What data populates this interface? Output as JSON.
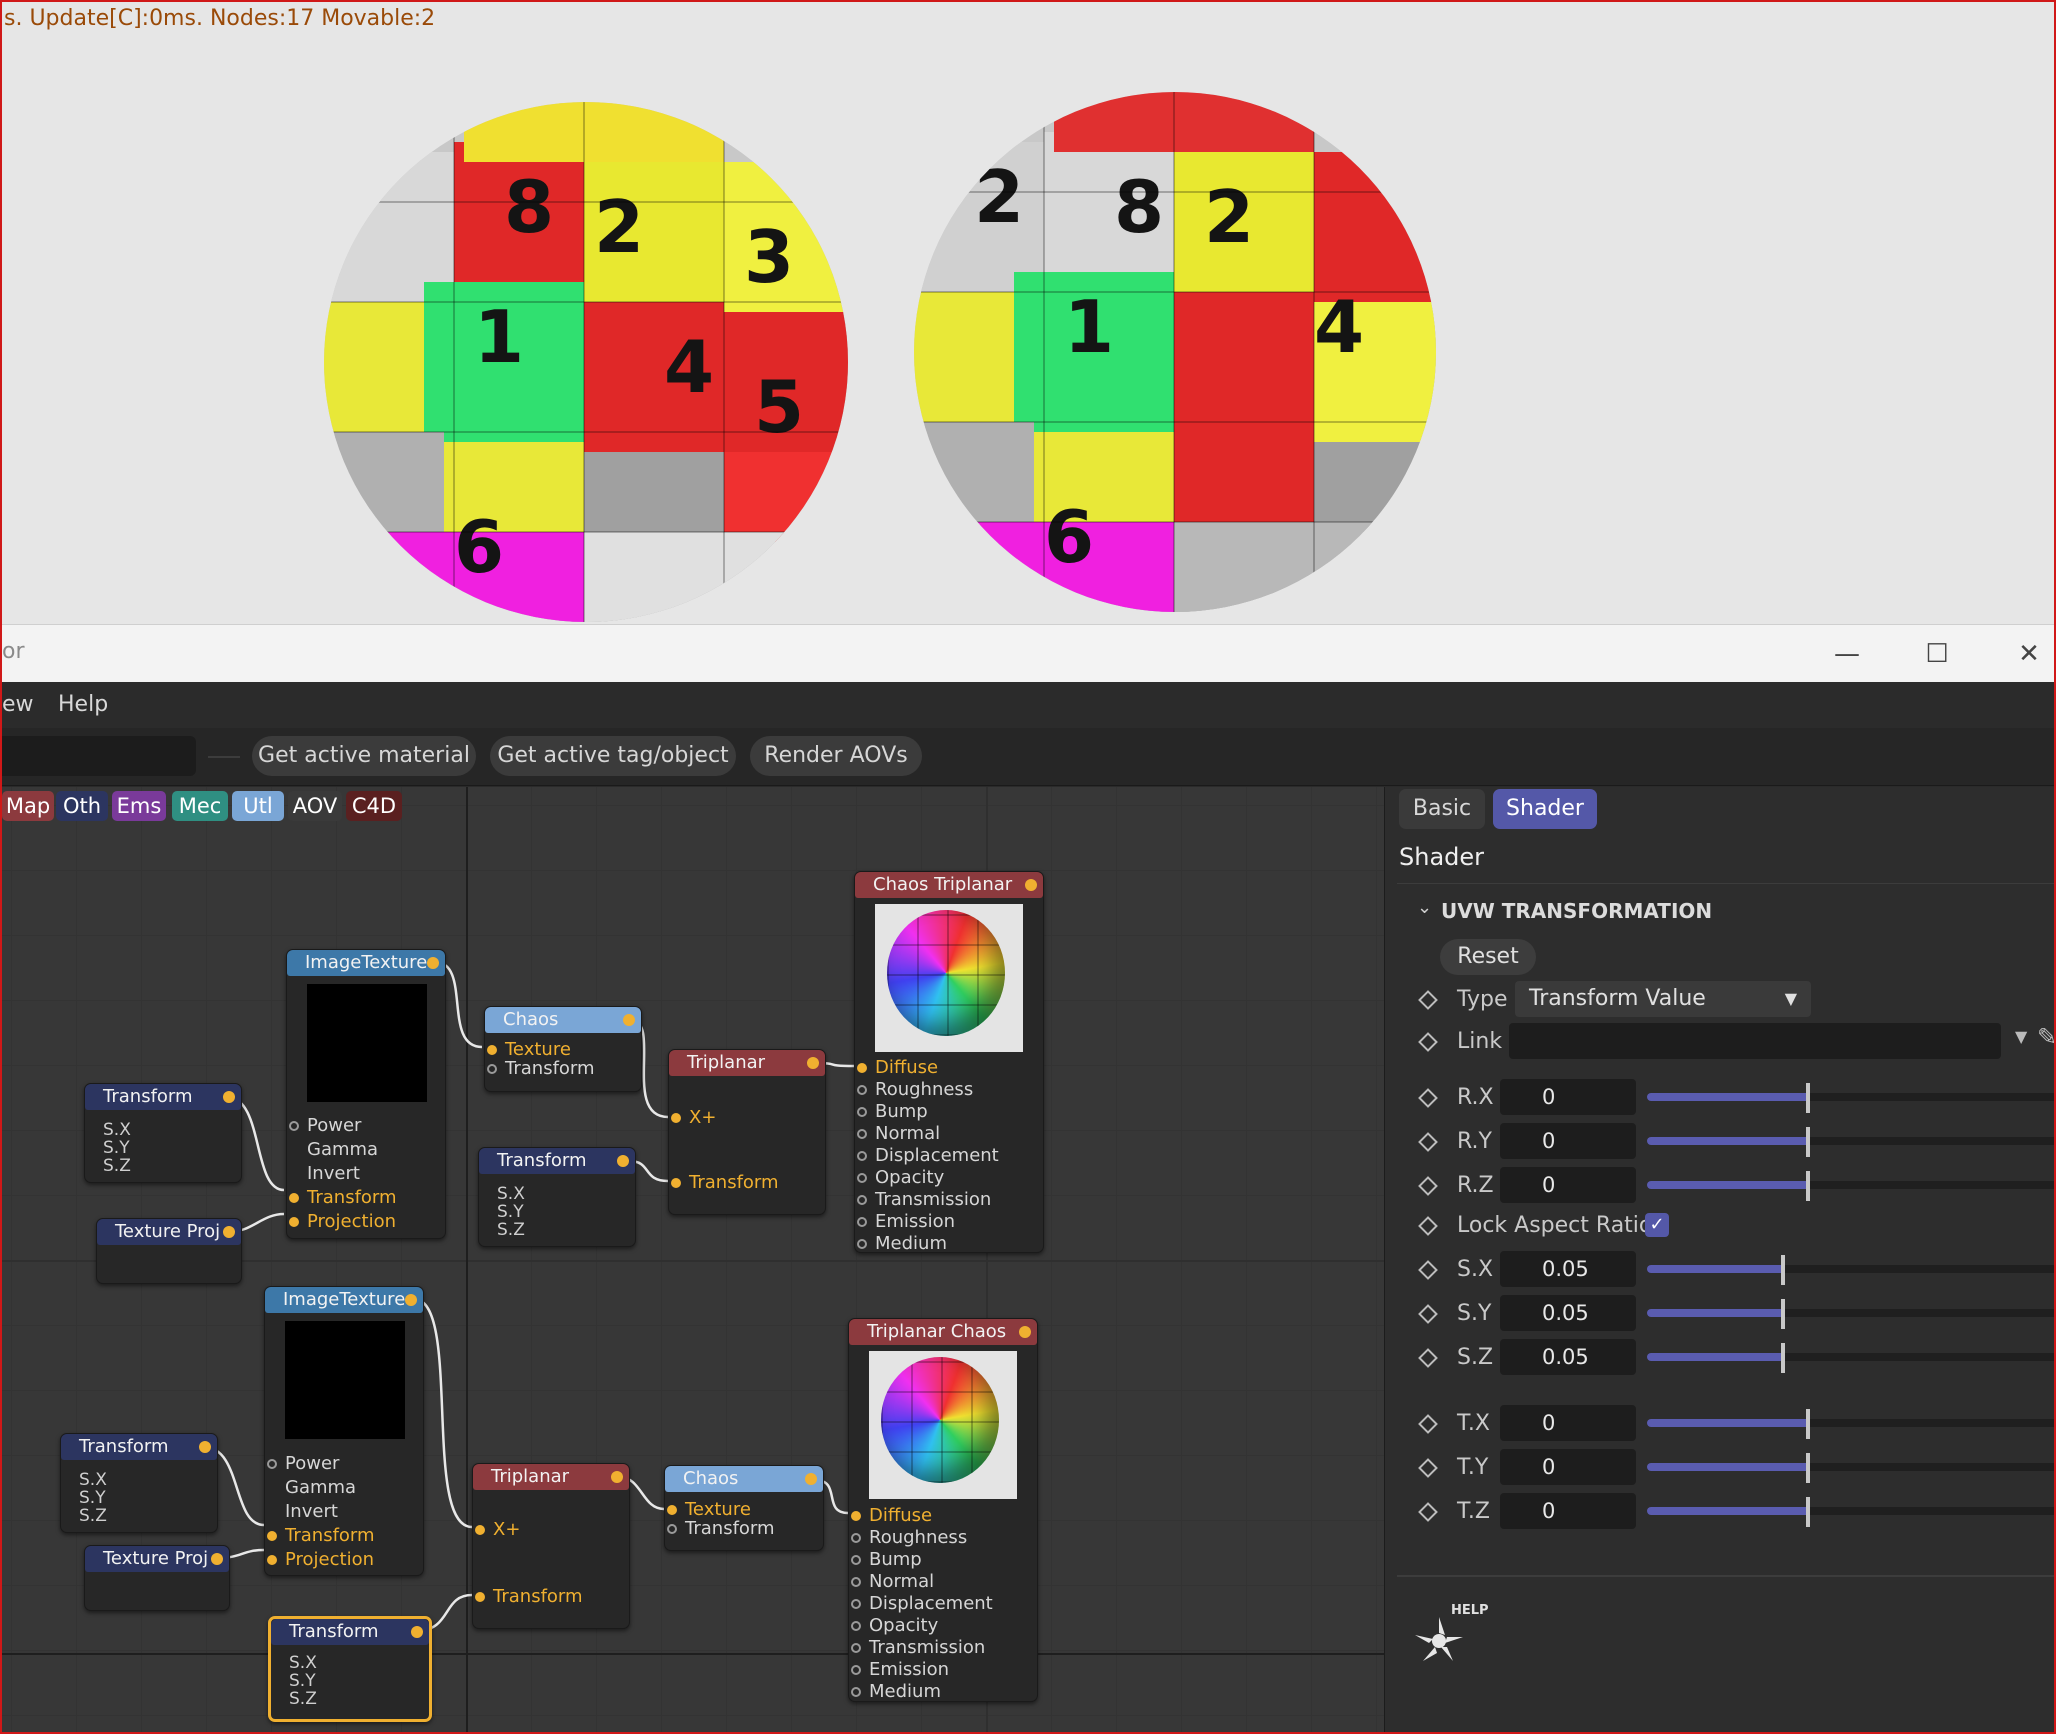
{
  "viewport": {
    "stats": "s. Update[C]:0ms. Nodes:17 Movable:2"
  },
  "window": {
    "title": "or",
    "minimize": "—",
    "maximize": "☐",
    "close": "✕"
  },
  "menu": {
    "items": [
      "ew",
      "Help"
    ]
  },
  "toolbar": {
    "buttons": [
      "Get active material",
      "Get active tag/object",
      "Render AOVs"
    ]
  },
  "categories": [
    {
      "label": "Map",
      "color": "#8c3a3e"
    },
    {
      "label": "Oth",
      "color": "#2c3560"
    },
    {
      "label": "Ems",
      "color": "#7a3a9a"
    },
    {
      "label": "Mec",
      "color": "#2f8f82"
    },
    {
      "label": "Utl",
      "color": "#7aa6d6"
    },
    {
      "label": "AOV",
      "color": "#3a3a3a"
    },
    {
      "label": "C4D",
      "color": "#5a2020"
    }
  ],
  "nodes": {
    "img1": {
      "title": "ImageTexture",
      "pins": [
        "Power",
        "Gamma",
        "Invert",
        "Transform",
        "Projection"
      ]
    },
    "chaos1": {
      "title": "Chaos",
      "pins": [
        "Texture",
        "Transform"
      ]
    },
    "tri1": {
      "title": "Triplanar",
      "pins": [
        "X+",
        "Transform"
      ]
    },
    "mat1": {
      "title": "Chaos Triplanar",
      "pins": [
        "Diffuse",
        "Roughness",
        "Bump",
        "Normal",
        "Displacement",
        "Opacity",
        "Transmission",
        "Emission",
        "Medium"
      ]
    },
    "xf1": {
      "title": "Transform",
      "subs": [
        "S.X",
        "S.Y",
        "S.Z"
      ]
    },
    "xf2": {
      "title": "Transform",
      "subs": [
        "S.X",
        "S.Y",
        "S.Z"
      ]
    },
    "proj1": {
      "title": "Texture Proj"
    },
    "img2": {
      "title": "ImageTexture",
      "pins": [
        "Power",
        "Gamma",
        "Invert",
        "Transform",
        "Projection"
      ]
    },
    "tri2": {
      "title": "Triplanar",
      "pins": [
        "X+",
        "Transform"
      ]
    },
    "chaos2": {
      "title": "Chaos",
      "pins": [
        "Texture",
        "Transform"
      ]
    },
    "mat2": {
      "title": "Triplanar Chaos",
      "pins": [
        "Diffuse",
        "Roughness",
        "Bump",
        "Normal",
        "Displacement",
        "Opacity",
        "Transmission",
        "Emission",
        "Medium"
      ]
    },
    "xf3": {
      "title": "Transform",
      "subs": [
        "S.X",
        "S.Y",
        "S.Z"
      ]
    },
    "xf4": {
      "title": "Transform",
      "subs": [
        "S.X",
        "S.Y",
        "S.Z"
      ]
    },
    "proj2": {
      "title": "Texture Proj"
    }
  },
  "panel": {
    "tabs": [
      "Basic",
      "Shader"
    ],
    "active_tab": "Shader",
    "title": "Shader",
    "section": "UVW TRANSFORMATION",
    "reset": "Reset",
    "type_label": "Type",
    "type_value": "Transform Value",
    "link_label": "Link",
    "lock_label": "Lock Aspect Ratio",
    "lock_checked": true,
    "params": [
      {
        "label": "R.X",
        "value": "0",
        "fill": 0.39
      },
      {
        "label": "R.Y",
        "value": "0",
        "fill": 0.39
      },
      {
        "label": "R.Z",
        "value": "0",
        "fill": 0.39
      },
      {
        "label": "S.X",
        "value": "0.05",
        "fill": 0.33
      },
      {
        "label": "S.Y",
        "value": "0.05",
        "fill": 0.33
      },
      {
        "label": "S.Z",
        "value": "0.05",
        "fill": 0.33
      },
      {
        "label": "T.X",
        "value": "0",
        "fill": 0.39
      },
      {
        "label": "T.Y",
        "value": "0",
        "fill": 0.39
      },
      {
        "label": "T.Z",
        "value": "0",
        "fill": 0.39
      }
    ],
    "help": "HELP"
  }
}
